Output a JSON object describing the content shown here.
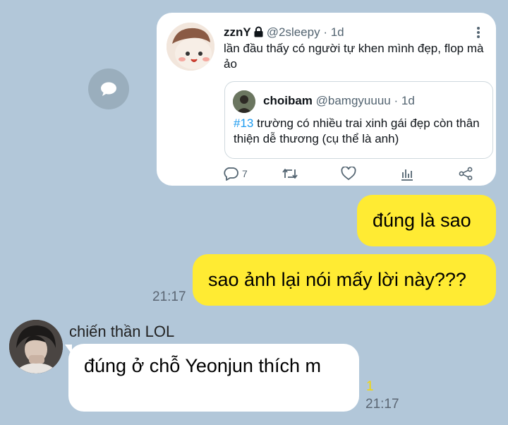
{
  "tweet": {
    "author_name": "zznY",
    "author_handle": "@2sleepy",
    "time": "· 1d",
    "text": "lần đầu thấy có người tự khen mình đẹp, flop mà ảo",
    "quote": {
      "author_name": "choibam",
      "author_handle": "@bamgyuuuu",
      "time": "· 1d",
      "hashtag": "#13",
      "text": " trường có nhiều trai xinh gái đẹp còn thân thiện dễ thương (cụ thể là anh)"
    },
    "reply_count": "7",
    "icons": {
      "more": "more-vertical-icon",
      "lock": "lock-icon",
      "reply": "reply-icon",
      "retweet": "retweet-icon",
      "like": "heart-icon",
      "analytics": "analytics-icon",
      "share": "share-icon"
    },
    "colors": {
      "hashtag": "#1d9bf0",
      "muted": "#536471"
    }
  },
  "share_button_icon": "speech-bubble-icon",
  "messages": {
    "outgoing": [
      {
        "text": "đúng là sao"
      },
      {
        "text": "sao ảnh lại nói mấy lời này???"
      }
    ],
    "outgoing_time": "21:17",
    "incoming": {
      "sender": "chiến thần LOL",
      "text": "đúng ở chỗ Yeonjun thích m",
      "unread": "1",
      "time": "21:17"
    }
  },
  "colors": {
    "background": "#b2c7d9",
    "outgoing_bubble": "#ffeb33",
    "incoming_bubble": "#ffffff",
    "unread": "#f5d700"
  }
}
